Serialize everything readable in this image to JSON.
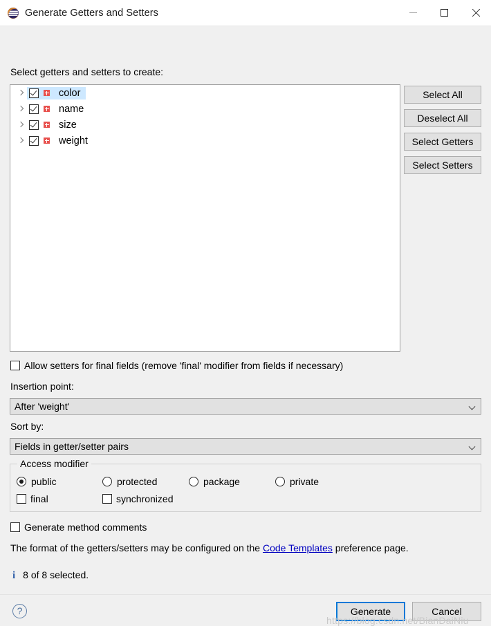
{
  "window": {
    "title": "Generate Getters and Setters",
    "icon": "eclipse-logo-icon",
    "controls": {
      "minimize": "minimize-icon",
      "maximize": "maximize-icon",
      "close": "close-icon"
    }
  },
  "main": {
    "tree_label": "Select getters and setters to create:",
    "fields": [
      {
        "name": "color",
        "checked": true,
        "selected": true,
        "icon": "private-field-icon"
      },
      {
        "name": "name",
        "checked": true,
        "selected": false,
        "icon": "private-field-icon"
      },
      {
        "name": "size",
        "checked": true,
        "selected": false,
        "icon": "private-field-icon"
      },
      {
        "name": "weight",
        "checked": true,
        "selected": false,
        "icon": "private-field-icon"
      }
    ],
    "side_buttons": [
      {
        "label": "Select All"
      },
      {
        "label": "Deselect All"
      },
      {
        "label": "Select Getters"
      },
      {
        "label": "Select Setters"
      }
    ],
    "allow_final_setters": {
      "label": "Allow setters for final fields (remove 'final' modifier from fields if necessary)",
      "checked": false
    },
    "insertion_point": {
      "label": "Insertion point:",
      "value": "After 'weight'"
    },
    "sort_by": {
      "label": "Sort by:",
      "value": "Fields in getter/setter pairs"
    },
    "access_modifier": {
      "title": "Access modifier",
      "radios": [
        {
          "label": "public",
          "selected": true
        },
        {
          "label": "protected",
          "selected": false
        },
        {
          "label": "package",
          "selected": false
        },
        {
          "label": "private",
          "selected": false
        }
      ],
      "checkboxes": [
        {
          "label": "final",
          "checked": false
        },
        {
          "label": "synchronized",
          "checked": false
        }
      ]
    },
    "generate_comments": {
      "label": "Generate method comments",
      "checked": false
    },
    "format_note": {
      "prefix": "The format of the getters/setters may be configured on the ",
      "link": "Code Templates",
      "suffix": " preference page."
    },
    "status": {
      "icon": "info-icon",
      "text": "8 of 8 selected."
    }
  },
  "footer": {
    "help_label": "?",
    "generate_label": "Generate",
    "cancel_label": "Cancel"
  },
  "watermark": "https://blog.csdn.net/BianDaiNiu",
  "colors": {
    "selection": "#cde8ff",
    "field_icon": "#e8524f",
    "accent": "#0078d7",
    "link": "#0000c0",
    "info": "#2f5fa8"
  }
}
